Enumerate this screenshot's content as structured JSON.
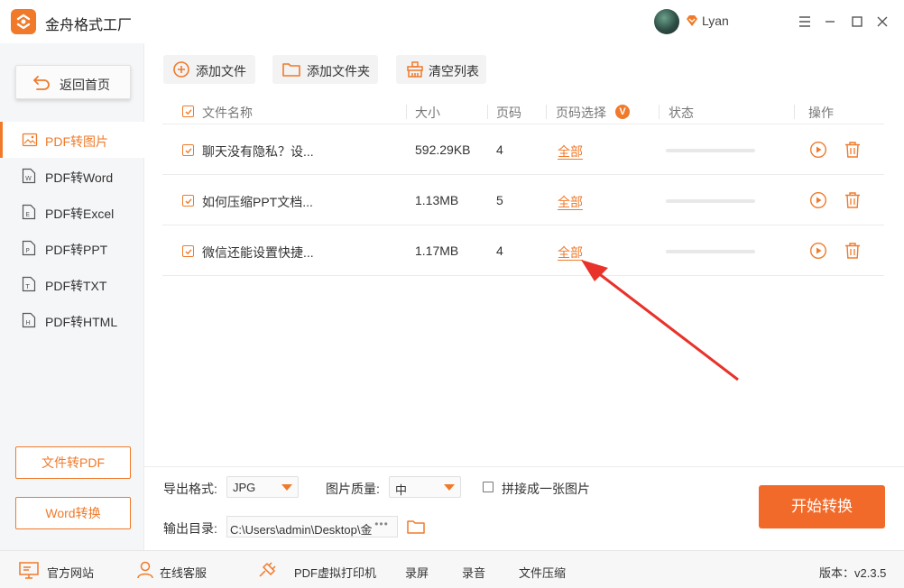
{
  "app": {
    "title": "金舟格式工厂",
    "user": "Lyan",
    "accent": "#f07a2a",
    "start_button_color": "#f26a2a"
  },
  "sidebar": {
    "home": "返回首页",
    "items": [
      {
        "label": "PDF转图片",
        "icon": "image-icon"
      },
      {
        "label": "PDF转Word",
        "icon": "word-file-icon"
      },
      {
        "label": "PDF转Excel",
        "icon": "excel-file-icon"
      },
      {
        "label": "PDF转PPT",
        "icon": "ppt-file-icon"
      },
      {
        "label": "PDF转TXT",
        "icon": "txt-file-icon"
      },
      {
        "label": "PDF转HTML",
        "icon": "html-file-icon"
      }
    ],
    "active_index": 0,
    "bottom_buttons": [
      "文件转PDF",
      "Word转换"
    ]
  },
  "toolbar": {
    "add_file": "添加文件",
    "add_folder": "添加文件夹",
    "clear_list": "清空列表"
  },
  "table": {
    "headers": {
      "name": "文件名称",
      "size": "大小",
      "pages": "页码",
      "page_select": "页码选择",
      "page_select_badge": "V",
      "status": "状态",
      "actions": "操作"
    },
    "rows": [
      {
        "name": "聊天没有隐私？设...",
        "size": "592.29KB",
        "pages": "4",
        "page_select": "全部",
        "progress": 0
      },
      {
        "name": "如何压缩PPT文档...",
        "size": "1.13MB",
        "pages": "5",
        "page_select": "全部",
        "progress": 0
      },
      {
        "name": "微信还能设置快捷...",
        "size": "1.17MB",
        "pages": "4",
        "page_select": "全部",
        "progress": 0
      }
    ]
  },
  "settings": {
    "format_label": "导出格式:",
    "format_value": "JPG",
    "quality_label": "图片质量:",
    "quality_value": "中",
    "merge_label": "拼接成一张图片",
    "merge_checked": false,
    "output_label": "输出目录:",
    "output_path": "C:\\Users\\admin\\Desktop\\金",
    "browse_button": "•••",
    "start_button": "开始转换"
  },
  "statusbar": {
    "website": "官方网站",
    "service": "在线客服",
    "printer": "PDF虚拟打印机",
    "screen_record": "录屏",
    "audio_record": "录音",
    "compress": "文件压缩",
    "version": "版本：v2.3.5"
  }
}
